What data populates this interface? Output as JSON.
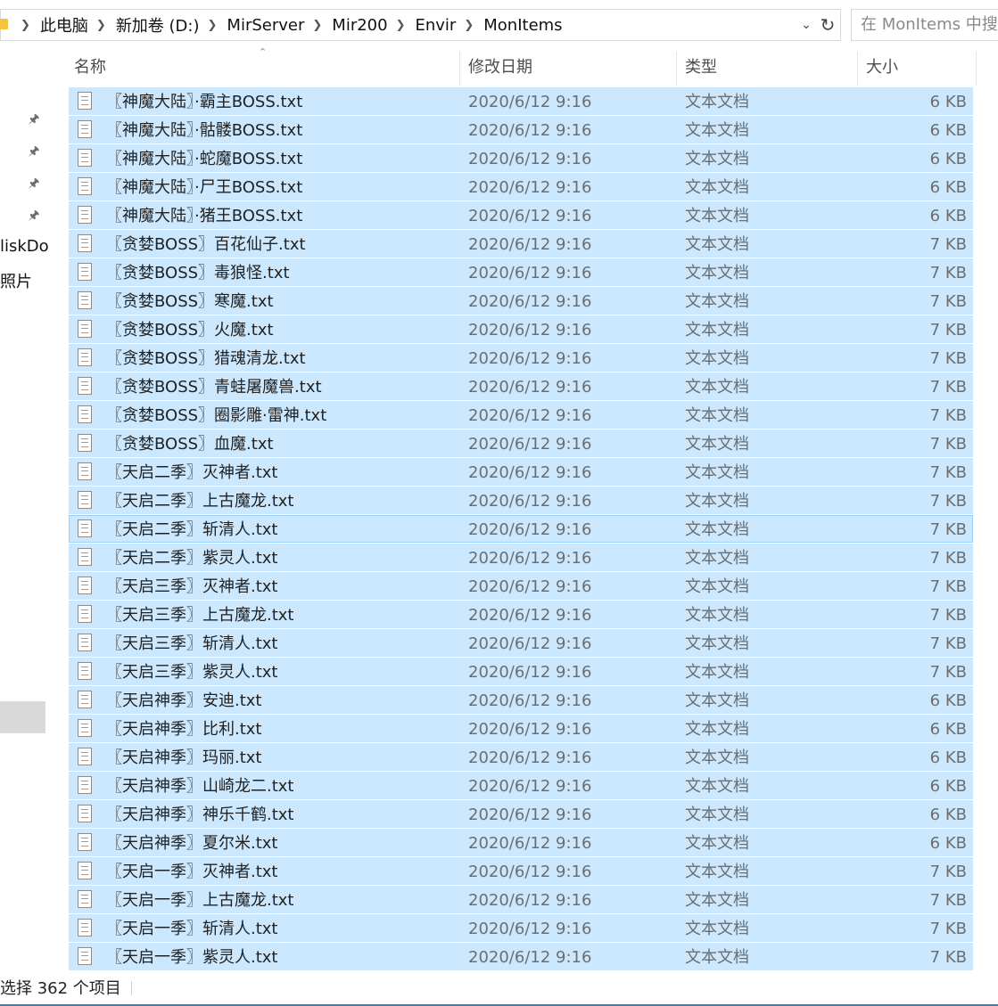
{
  "address": {
    "crumbs": [
      "此电脑",
      "新加卷 (D:)",
      "MirServer",
      "Mir200",
      "Envir",
      "MonItems"
    ],
    "dropdown_icon": "chevron-down-icon",
    "refresh_icon": "refresh-icon"
  },
  "search": {
    "placeholder": "在 MonItems 中搜索"
  },
  "nav": {
    "pin_icons": [
      "pin-icon",
      "pin-icon",
      "pin-icon",
      "pin-icon"
    ],
    "item1": "liskDo",
    "item2": "照片"
  },
  "columns": {
    "name": "名称",
    "date": "修改日期",
    "type": "类型",
    "size": "大小"
  },
  "files": [
    {
      "name": "〖神魔大陆〗·霸主BOSS.txt",
      "date": "2020/6/12 9:16",
      "type": "文本文档",
      "size": "6 KB"
    },
    {
      "name": "〖神魔大陆〗·骷髅BOSS.txt",
      "date": "2020/6/12 9:16",
      "type": "文本文档",
      "size": "6 KB"
    },
    {
      "name": "〖神魔大陆〗·蛇魔BOSS.txt",
      "date": "2020/6/12 9:16",
      "type": "文本文档",
      "size": "6 KB"
    },
    {
      "name": "〖神魔大陆〗·尸王BOSS.txt",
      "date": "2020/6/12 9:16",
      "type": "文本文档",
      "size": "6 KB"
    },
    {
      "name": "〖神魔大陆〗·猪王BOSS.txt",
      "date": "2020/6/12 9:16",
      "type": "文本文档",
      "size": "6 KB"
    },
    {
      "name": "〖贪婪BOSS〗百花仙子.txt",
      "date": "2020/6/12 9:16",
      "type": "文本文档",
      "size": "7 KB"
    },
    {
      "name": "〖贪婪BOSS〗毒狼怪.txt",
      "date": "2020/6/12 9:16",
      "type": "文本文档",
      "size": "7 KB"
    },
    {
      "name": "〖贪婪BOSS〗寒魔.txt",
      "date": "2020/6/12 9:16",
      "type": "文本文档",
      "size": "7 KB"
    },
    {
      "name": "〖贪婪BOSS〗火魔.txt",
      "date": "2020/6/12 9:16",
      "type": "文本文档",
      "size": "7 KB"
    },
    {
      "name": "〖贪婪BOSS〗猎魂清龙.txt",
      "date": "2020/6/12 9:16",
      "type": "文本文档",
      "size": "7 KB"
    },
    {
      "name": "〖贪婪BOSS〗青蛙屠魔兽.txt",
      "date": "2020/6/12 9:16",
      "type": "文本文档",
      "size": "7 KB"
    },
    {
      "name": "〖贪婪BOSS〗圈影雕·雷神.txt",
      "date": "2020/6/12 9:16",
      "type": "文本文档",
      "size": "7 KB"
    },
    {
      "name": "〖贪婪BOSS〗血魔.txt",
      "date": "2020/6/12 9:16",
      "type": "文本文档",
      "size": "7 KB"
    },
    {
      "name": "〖天启二季〗灭神者.txt",
      "date": "2020/6/12 9:16",
      "type": "文本文档",
      "size": "7 KB"
    },
    {
      "name": "〖天启二季〗上古魔龙.txt",
      "date": "2020/6/12 9:16",
      "type": "文本文档",
      "size": "7 KB"
    },
    {
      "name": "〖天启二季〗斩清人.txt",
      "date": "2020/6/12 9:16",
      "type": "文本文档",
      "size": "7 KB"
    },
    {
      "name": "〖天启二季〗紫灵人.txt",
      "date": "2020/6/12 9:16",
      "type": "文本文档",
      "size": "7 KB"
    },
    {
      "name": "〖天启三季〗灭神者.txt",
      "date": "2020/6/12 9:16",
      "type": "文本文档",
      "size": "7 KB"
    },
    {
      "name": "〖天启三季〗上古魔龙.txt",
      "date": "2020/6/12 9:16",
      "type": "文本文档",
      "size": "7 KB"
    },
    {
      "name": "〖天启三季〗斩清人.txt",
      "date": "2020/6/12 9:16",
      "type": "文本文档",
      "size": "7 KB"
    },
    {
      "name": "〖天启三季〗紫灵人.txt",
      "date": "2020/6/12 9:16",
      "type": "文本文档",
      "size": "7 KB"
    },
    {
      "name": "〖天启神季〗安迪.txt",
      "date": "2020/6/12 9:16",
      "type": "文本文档",
      "size": "6 KB"
    },
    {
      "name": "〖天启神季〗比利.txt",
      "date": "2020/6/12 9:16",
      "type": "文本文档",
      "size": "6 KB"
    },
    {
      "name": "〖天启神季〗玛丽.txt",
      "date": "2020/6/12 9:16",
      "type": "文本文档",
      "size": "6 KB"
    },
    {
      "name": "〖天启神季〗山崎龙二.txt",
      "date": "2020/6/12 9:16",
      "type": "文本文档",
      "size": "6 KB"
    },
    {
      "name": "〖天启神季〗神乐千鹤.txt",
      "date": "2020/6/12 9:16",
      "type": "文本文档",
      "size": "6 KB"
    },
    {
      "name": "〖天启神季〗夏尔米.txt",
      "date": "2020/6/12 9:16",
      "type": "文本文档",
      "size": "6 KB"
    },
    {
      "name": "〖天启一季〗灭神者.txt",
      "date": "2020/6/12 9:16",
      "type": "文本文档",
      "size": "7 KB"
    },
    {
      "name": "〖天启一季〗上古魔龙.txt",
      "date": "2020/6/12 9:16",
      "type": "文本文档",
      "size": "7 KB"
    },
    {
      "name": "〖天启一季〗斩清人.txt",
      "date": "2020/6/12 9:16",
      "type": "文本文档",
      "size": "7 KB"
    },
    {
      "name": "〖天启一季〗紫灵人.txt",
      "date": "2020/6/12 9:16",
      "type": "文本文档",
      "size": "7 KB"
    }
  ],
  "focused_index": 15,
  "status": {
    "text": "选择 362 个项目"
  },
  "colors": {
    "selection": "#cce8ff",
    "focus_outline": "#99d1ff",
    "accent": "#3c7fb1"
  }
}
